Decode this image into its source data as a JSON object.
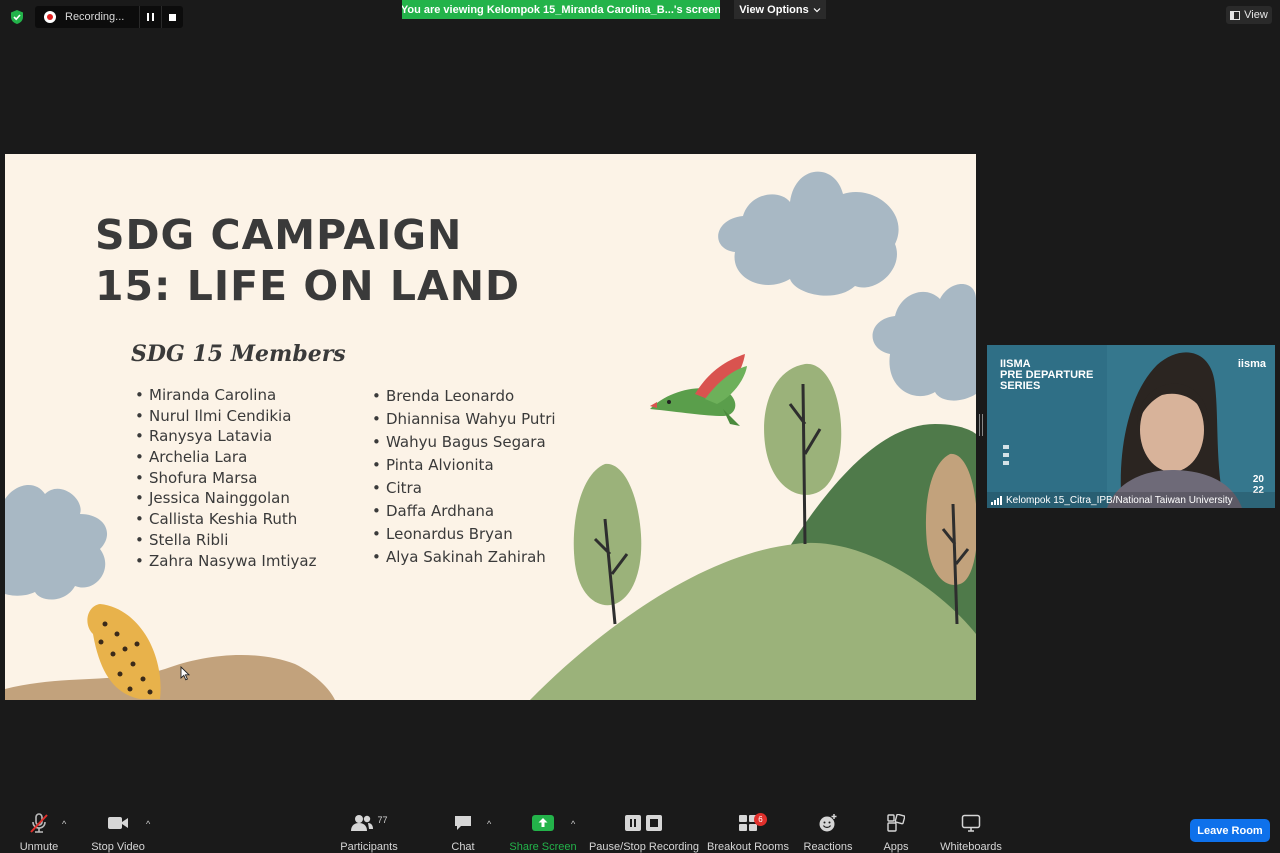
{
  "top_bar": {
    "recording_status": "Recording...",
    "viewing_banner": "You are viewing Kelompok 15_Miranda Carolina_B...'s screen",
    "view_options_label": "View Options",
    "view_label": "View"
  },
  "slide": {
    "title_line1": "SDG CAMPAIGN",
    "title_line2": "15: LIFE ON LAND",
    "members_heading": "SDG 15 Members",
    "members_col1": [
      "Miranda Carolina",
      "Nurul Ilmi Cendikia",
      "Ranysya Latavia",
      "Archelia Lara",
      "Shofura Marsa",
      "Jessica Nainggolan",
      "Callista Keshia Ruth",
      "Stella Ribli",
      "Zahra Nasywa Imtiyaz"
    ],
    "members_col2": [
      "Brenda Leonardo",
      "Dhiannisa Wahyu Putri",
      "Wahyu Bagus Segara",
      "Pinta Alvionita",
      "Citra",
      "Daffa Ardhana",
      "Leonardus Bryan",
      "Alya Sakinah Zahirah"
    ]
  },
  "video_tile": {
    "title_line1": "IISMA",
    "title_line2": "PRE DEPARTURE",
    "title_line3": "SERIES",
    "brand_logo": "iisma",
    "year_line1": "20",
    "year_line2": "22",
    "participant_name": "Kelompok 15_Citra_IPB/National Taiwan University"
  },
  "toolbar": {
    "unmute_label": "Unmute",
    "stop_video_label": "Stop Video",
    "participants_label": "Participants",
    "participants_count": "77",
    "chat_label": "Chat",
    "share_screen_label": "Share Screen",
    "recording_label": "Pause/Stop Recording",
    "breakout_label": "Breakout Rooms",
    "breakout_badge": "6",
    "reactions_label": "Reactions",
    "apps_label": "Apps",
    "whiteboards_label": "Whiteboards",
    "leave_label": "Leave Room"
  },
  "colors": {
    "banner_green": "#23b34a",
    "share_green": "#23b34a",
    "leave_blue": "#0e71eb",
    "slide_background": "#fcf3e7",
    "badge_red": "#e0302c"
  }
}
